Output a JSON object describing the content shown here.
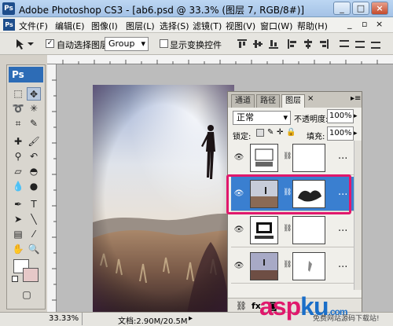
{
  "window": {
    "title": "Adobe Photoshop CS3 - [ab6.psd @ 33.3% (图层 7, RGB/8#)]",
    "app_icon": "Ps",
    "controls": [
      "_",
      "□",
      "×"
    ]
  },
  "menubar": {
    "items": [
      "文件(F)",
      "编辑(E)",
      "图像(I)",
      "图层(L)",
      "选择(S)",
      "滤镜(T)",
      "视图(V)",
      "窗口(W)",
      "帮助(H)"
    ],
    "right_controls": [
      "_",
      "▫",
      "×"
    ]
  },
  "options": {
    "auto_select_label": "自动选择图层",
    "auto_select_checked": true,
    "group_value": "Group",
    "show_transform_label": "显示变换控件",
    "show_transform_checked": false
  },
  "tools": {
    "logo": "Ps"
  },
  "status": {
    "zoom": "33.33%",
    "doc_info": "文档:2.90M/20.5M"
  },
  "layers_panel": {
    "tabs": [
      "通道",
      "路径",
      "图层"
    ],
    "active_tab": "图层",
    "blend_mode": "正常",
    "opacity_label": "不透明度:",
    "opacity_value": "100%",
    "lock_label": "锁定:",
    "fill_label": "填充:",
    "fill_value": "100%",
    "layers": [
      {
        "selected": false,
        "more": "..."
      },
      {
        "selected": true,
        "more": "..."
      },
      {
        "selected": false,
        "more": "..."
      },
      {
        "selected": false,
        "more": "..."
      }
    ]
  },
  "watermark": {
    "logo_text_1": "asp",
    "logo_text_2": "ku",
    "logo_suffix": ".com",
    "subtitle": "免费网站源码下载站!"
  },
  "colors": {
    "highlight": "#e0186c",
    "selected_layer": "#3a7fd0"
  }
}
